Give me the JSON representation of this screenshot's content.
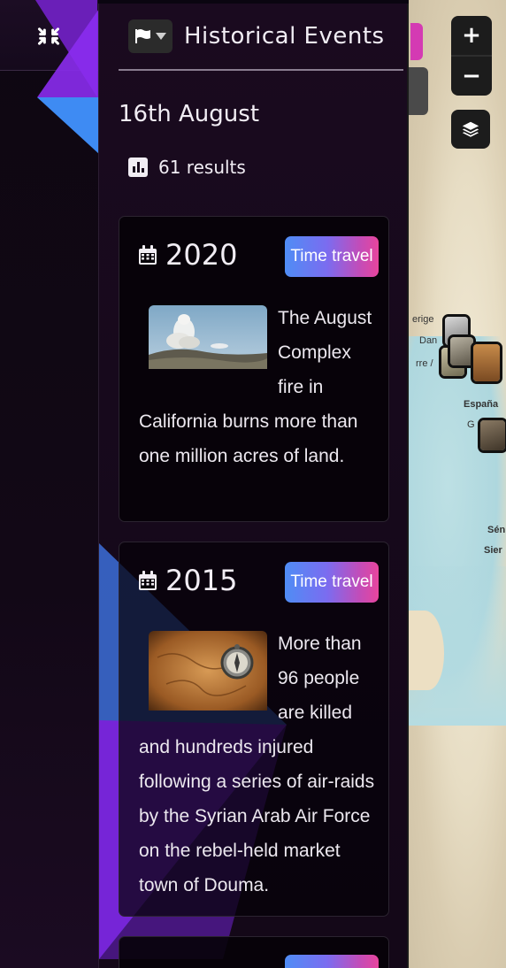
{
  "panel": {
    "title": "Historical Events",
    "date": "16th August",
    "results": "61 results"
  },
  "events": [
    {
      "year": "2020",
      "button": "Time travel",
      "text": "The August Complex fire in California burns more than one million acres of land."
    },
    {
      "year": "2015",
      "button": "Time travel",
      "text": "More than 96 people are killed and hundreds injured following a series of air-raids by the Syrian Arab Air Force on the rebel-held market town of Douma."
    },
    {
      "year": "",
      "button": "",
      "text": ""
    }
  ],
  "map": {
    "labels": [
      "erige",
      "Dan",
      "rre /",
      "España",
      "G",
      "Sén",
      "Sier"
    ],
    "zoom_in": "+",
    "zoom_out": "−"
  },
  "icons": {
    "collapse": "collapse-arrows-icon",
    "flag": "flag-icon",
    "caret": "caret-down-icon",
    "results": "bar-chart-icon",
    "calendar": "calendar-icon",
    "layers": "layers-icon"
  },
  "colors": {
    "panel_bg": "#17091c",
    "button_gradient_start": "#4f8df5",
    "button_gradient_end": "#e8459d",
    "accent_purple": "#8b2cf0"
  }
}
